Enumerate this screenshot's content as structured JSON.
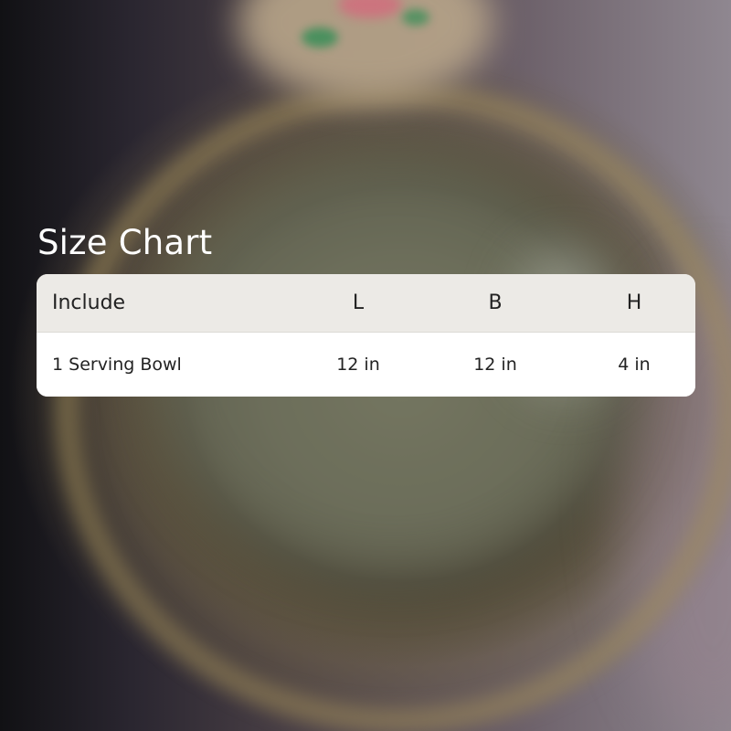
{
  "heading": "Size Chart",
  "table": {
    "headers": {
      "include": "Include",
      "l": "L",
      "b": "B",
      "h": "H"
    },
    "rows": [
      {
        "include": "1 Serving Bowl",
        "l": "12 in",
        "b": "12 in",
        "h": "4 in"
      }
    ]
  },
  "colors": {
    "heading_text": "#ffffff",
    "table_header_bg": "#eceae6",
    "table_body_bg": "#ffffff",
    "table_text": "#222222"
  }
}
